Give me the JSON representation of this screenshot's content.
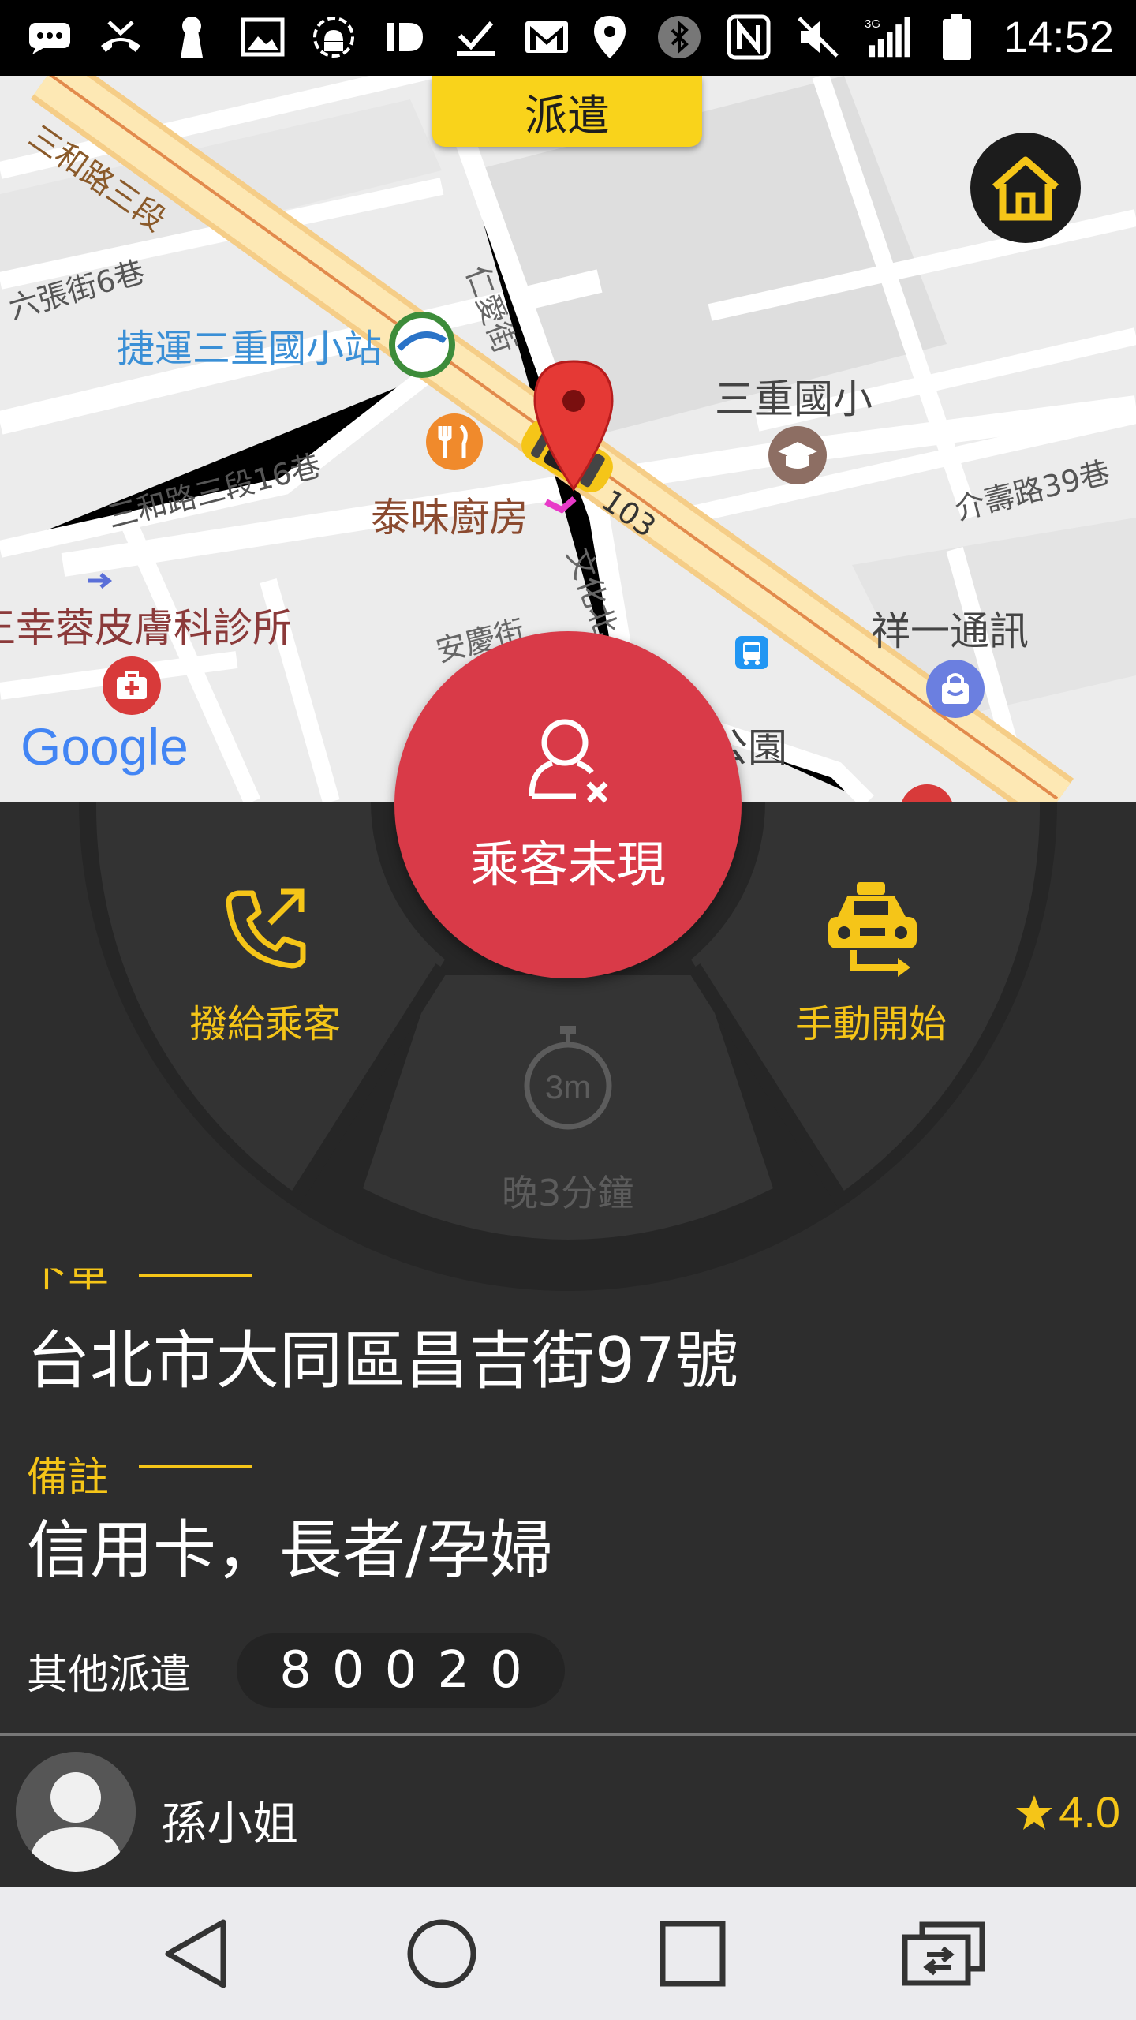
{
  "status_bar": {
    "time": "14:52",
    "left_icons": [
      "message-icon",
      "missed-call-icon",
      "keyhole-icon",
      "image-icon",
      "android-debug-icon",
      "id-icon",
      "check-icon",
      "gmail-icon"
    ],
    "right_icons": [
      "location-icon",
      "bluetooth-icon",
      "nfc-icon",
      "mute-icon",
      "signal-3g-icon",
      "battery-icon"
    ],
    "network": "3G"
  },
  "map": {
    "dispatch_tab_label": "派遣",
    "labels": {
      "road_sanhe": "三和路三段",
      "lane_6": "六張街6巷",
      "mrt_station": "捷運三重國小站",
      "renai_st": "仁愛街",
      "school": "三重國小",
      "sanhe_lane16": "三和路三段16巷",
      "restaurant": "泰味廚房",
      "route_no": "103",
      "jieshou_lane": "介壽路39巷",
      "clinic": "王幸蓉皮膚科診所",
      "wenhua_rd": "文化北",
      "anqing_st": "安慶街",
      "telecom": "祥一通訊",
      "park": "公園",
      "google": "Google"
    }
  },
  "actions": {
    "passenger_no_show": "乘客未現",
    "call_passenger": "撥給乘客",
    "manual_start": "手動開始",
    "late_3min": "晚3分鐘",
    "late_badge": "3m"
  },
  "trip": {
    "dropoff_label": "下車",
    "address": "台北市大同區昌吉街97號",
    "note_label": "備註",
    "note": "信用卡，長者/孕婦",
    "other_dispatch_label": "其他派遣",
    "other_dispatch_code": "80020"
  },
  "customer": {
    "name": "孫小姐",
    "rating": "4.0"
  },
  "colors": {
    "accent_yellow": "#f5c518",
    "tab_yellow": "#f9d31b",
    "noshow_red": "#d93a48",
    "panel_dark": "#2d2d2d"
  }
}
